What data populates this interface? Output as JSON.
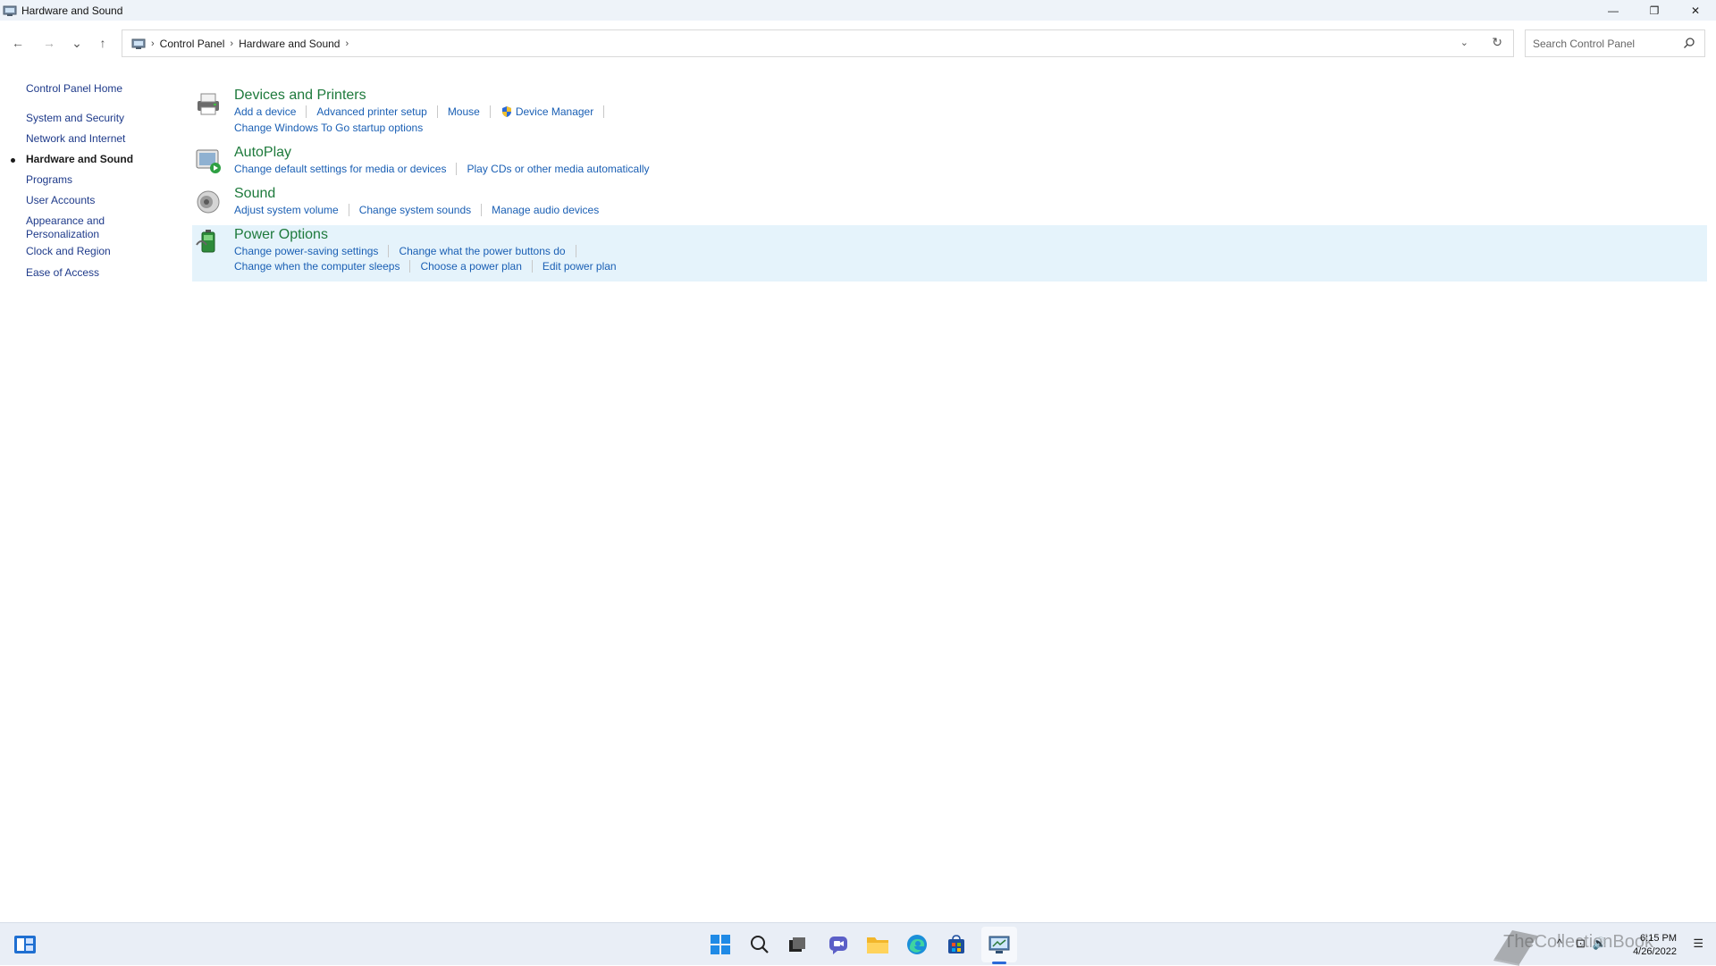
{
  "window": {
    "title": "Hardware and Sound",
    "minimize_glyph": "—",
    "maximize_glyph": "❐",
    "close_glyph": "✕"
  },
  "nav": {
    "back_glyph": "←",
    "forward_glyph": "→",
    "recent_glyph": "⌄",
    "up_glyph": "↑",
    "breadcrumb": [
      "Control Panel",
      "Hardware and Sound"
    ],
    "crumb_separator": "›",
    "dropdown_glyph": "⌄",
    "refresh_glyph": "↻",
    "search_placeholder": "Search Control Panel"
  },
  "sidebar": {
    "items": [
      {
        "label": "Control Panel Home"
      },
      {
        "label": "System and Security"
      },
      {
        "label": "Network and Internet"
      },
      {
        "label": "Hardware and Sound",
        "active": true
      },
      {
        "label": "Programs"
      },
      {
        "label": "User Accounts"
      },
      {
        "label": "Appearance and Personalization"
      },
      {
        "label": "Clock and Region"
      },
      {
        "label": "Ease of Access"
      }
    ]
  },
  "sections": {
    "devices": {
      "heading": "Devices and Printers",
      "icon": "printer-icon",
      "links_row1": [
        "Add a device",
        "Advanced printer setup",
        "Mouse",
        "Device Manager"
      ],
      "links_row2": [
        "Change Windows To Go startup options"
      ]
    },
    "autoplay": {
      "heading": "AutoPlay",
      "icon": "autoplay-icon",
      "links_row1": [
        "Change default settings for media or devices",
        "Play CDs or other media automatically"
      ]
    },
    "sound": {
      "heading": "Sound",
      "icon": "speaker-icon",
      "links_row1": [
        "Adjust system volume",
        "Change system sounds",
        "Manage audio devices"
      ]
    },
    "power": {
      "heading": "Power Options",
      "icon": "battery-icon",
      "links_row1": [
        "Change power-saving settings",
        "Change what the power buttons do"
      ],
      "links_row2": [
        "Change when the computer sleeps",
        "Choose a power plan",
        "Edit power plan"
      ]
    }
  },
  "taskbar": {
    "time": "6:15 PM",
    "date": "4/26/2022",
    "watermark": "TheCollectionBook",
    "tray_chevron_glyph": "^",
    "network_glyph": "⊡",
    "volume_glyph": "🔊",
    "notification_glyph": "☰"
  },
  "colors": {
    "link": "#1a5fb4",
    "heading": "#1e7a3c",
    "highlight": "#e5f3fb",
    "sidebar_link": "#1e3a8a"
  }
}
